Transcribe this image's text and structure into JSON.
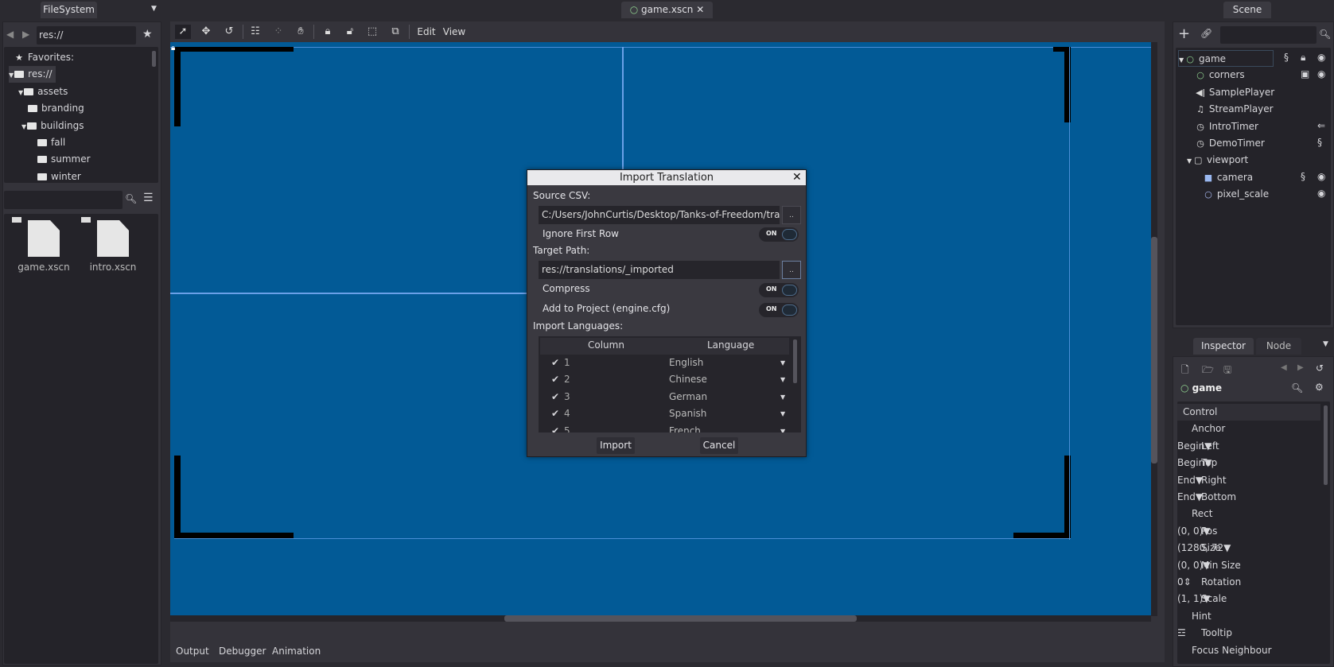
{
  "filesystem": {
    "tab": "FileSystem",
    "path": "res://",
    "tree": [
      {
        "label": "Favorites:",
        "icon": "star-icon",
        "depth": 0
      },
      {
        "label": "res://",
        "icon": "folder-icon",
        "depth": 0,
        "expanded": true,
        "selected": true
      },
      {
        "label": "assets",
        "icon": "folder-icon",
        "depth": 1,
        "expanded": true
      },
      {
        "label": "branding",
        "icon": "folder-icon",
        "depth": 2
      },
      {
        "label": "buildings",
        "icon": "folder-icon",
        "depth": 2,
        "expanded": true
      },
      {
        "label": "fall",
        "icon": "folder-icon",
        "depth": 3
      },
      {
        "label": "summer",
        "icon": "folder-icon",
        "depth": 3
      },
      {
        "label": "winter",
        "icon": "folder-icon",
        "depth": 3
      }
    ],
    "files": [
      "game.xscn",
      "intro.xscn"
    ]
  },
  "editor": {
    "open_tab": "game.xscn",
    "menu": {
      "edit": "Edit",
      "view": "View"
    }
  },
  "bottom": {
    "tabs": [
      "Output",
      "Debugger",
      "Animation"
    ]
  },
  "scene": {
    "tab": "Scene",
    "nodes": [
      {
        "label": "game",
        "icon": "control-icon",
        "depth": 0
      },
      {
        "label": "corners",
        "icon": "control-icon",
        "depth": 1
      },
      {
        "label": "SamplePlayer",
        "icon": "speaker-icon",
        "depth": 1
      },
      {
        "label": "StreamPlayer",
        "icon": "music-icon",
        "depth": 1
      },
      {
        "label": "IntroTimer",
        "icon": "timer-icon",
        "depth": 1
      },
      {
        "label": "DemoTimer",
        "icon": "timer-icon",
        "depth": 1
      },
      {
        "label": "viewport",
        "icon": "viewport-icon",
        "depth": 1
      },
      {
        "label": "camera",
        "icon": "camera-icon",
        "depth": 2
      },
      {
        "label": "pixel_scale",
        "icon": "node-icon",
        "depth": 2
      }
    ]
  },
  "inspector": {
    "tabs": [
      "Inspector",
      "Node"
    ],
    "node": "game",
    "props": [
      {
        "label": "Control",
        "level": 0
      },
      {
        "label": "Anchor",
        "level": 1
      },
      {
        "label": "Left",
        "value": "Begin",
        "level": 2
      },
      {
        "label": "Top",
        "value": "Begin",
        "level": 2
      },
      {
        "label": "Right",
        "value": "End",
        "level": 2
      },
      {
        "label": "Bottom",
        "value": "End",
        "level": 2
      },
      {
        "label": "Rect",
        "level": 1
      },
      {
        "label": "Pos",
        "value": "(0, 0)",
        "level": 2
      },
      {
        "label": "Size",
        "value": "(1280, 72",
        "level": 2
      },
      {
        "label": "Min Size",
        "value": "(0, 0)",
        "level": 2
      },
      {
        "label": "Rotation",
        "value": "0",
        "level": 2
      },
      {
        "label": "Scale",
        "value": "(1, 1)",
        "level": 2
      },
      {
        "label": "Hint",
        "level": 1
      },
      {
        "label": "Tooltip",
        "level": 2
      },
      {
        "label": "Focus Neighbour",
        "level": 1
      }
    ]
  },
  "dialog": {
    "title": "Import Translation",
    "source_label": "Source CSV:",
    "source_value": "C:/Users/JohnCurtis/Desktop/Tanks-of-Freedom/tran",
    "browse": "..",
    "ignore_first_row": "Ignore First Row",
    "target_label": "Target Path:",
    "target_value": "res://translations/_imported",
    "compress": "Compress",
    "add_to_project": "Add to Project (engine.cfg)",
    "toggle_on": "ON",
    "languages_label": "Import Languages:",
    "col_column": "Column",
    "col_language": "Language",
    "rows": [
      {
        "n": "1",
        "lang": "English"
      },
      {
        "n": "2",
        "lang": "Chinese"
      },
      {
        "n": "3",
        "lang": "German"
      },
      {
        "n": "4",
        "lang": "Spanish"
      },
      {
        "n": "5",
        "lang": "French"
      }
    ],
    "import": "Import",
    "cancel": "Cancel"
  }
}
